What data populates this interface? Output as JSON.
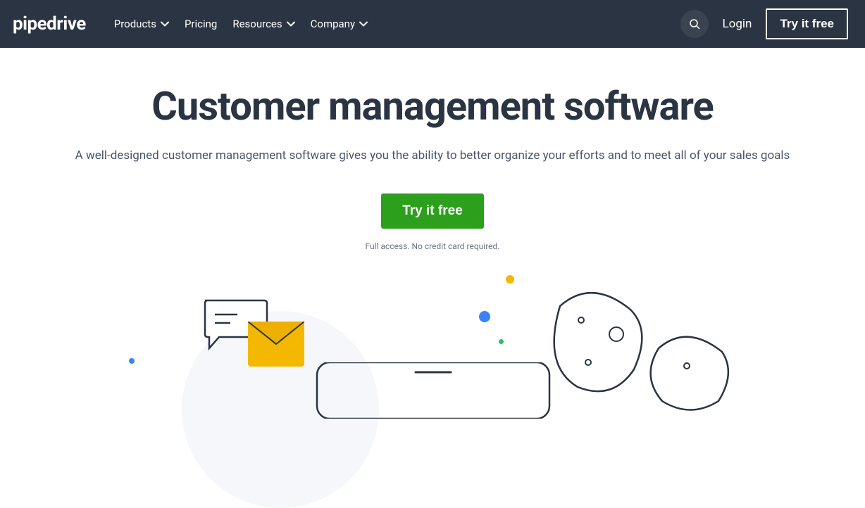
{
  "header": {
    "logo": "pipedrive",
    "nav": {
      "products": "Products",
      "pricing": "Pricing",
      "resources": "Resources",
      "company": "Company"
    },
    "login": "Login",
    "try_free": "Try it free"
  },
  "hero": {
    "title": "Customer management software",
    "subtitle": "A well-designed customer management software gives you the ability to better organize your efforts and to meet all of your sales goals",
    "cta_label": "Try it free",
    "cta_subtext": "Full access. No credit card required."
  }
}
